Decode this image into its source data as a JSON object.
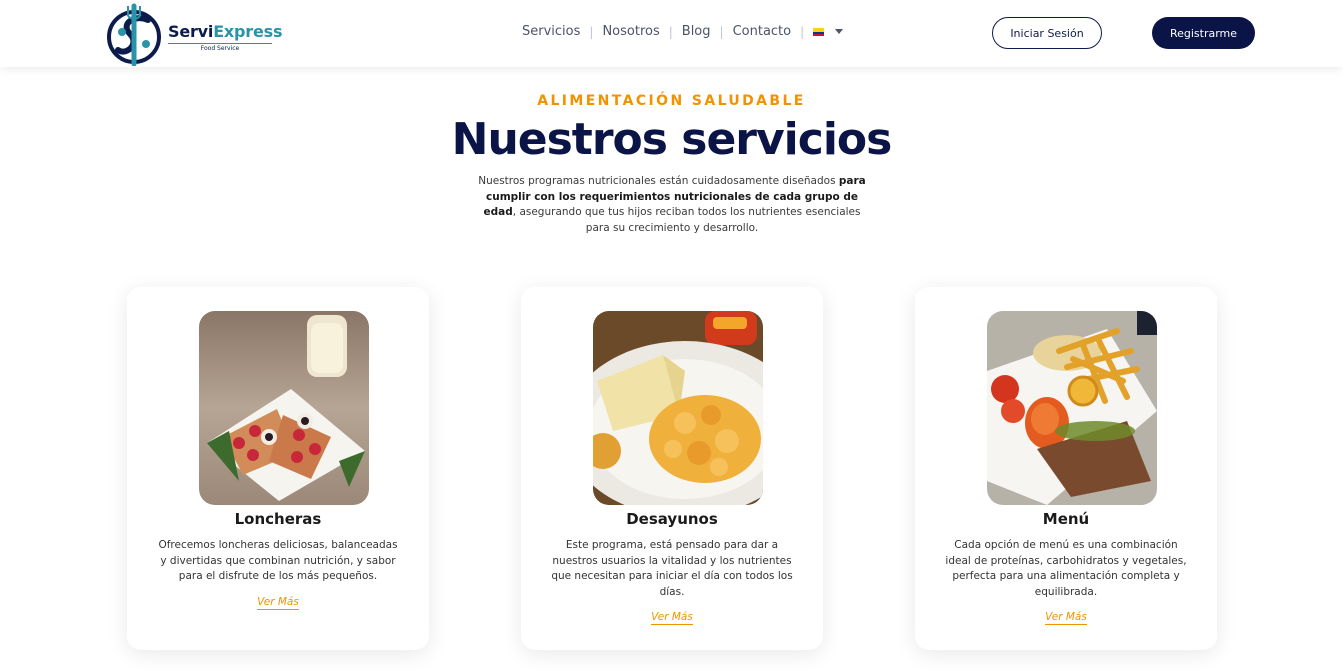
{
  "brand": {
    "name_part1": "Servi",
    "name_part2": "Express",
    "tagline": "Food Service"
  },
  "nav": {
    "items": [
      "Servicios",
      "Nosotros",
      "Blog",
      "Contacto"
    ],
    "language_flag": "colombia-flag-icon"
  },
  "auth": {
    "login_label": "Iniciar Sesión",
    "register_label": "Registrarme"
  },
  "hero": {
    "eyebrow": "ALIMENTACIÓN SALUDABLE",
    "title": "Nuestros servicios",
    "intro_part1": "Nuestros programas nutricionales están cuidadosamente diseñados ",
    "intro_bold": "para cumplir con los requerimientos nutricionales de cada grupo de edad",
    "intro_part2": ", asegurando que tus hijos reciban todos los nutrientes esenciales para su crecimiento y desarrollo."
  },
  "cards": [
    {
      "title": "Loncheras",
      "description": "Ofrecemos loncheras deliciosas, balanceadas y divertidas que combinan nutrición, y sabor para el disfrute de los más pequeños.",
      "link": "Ver Más"
    },
    {
      "title": "Desayunos",
      "description": "Este programa, está pensado para dar a nuestros usuarios la vitalidad y los nutrientes que necesitan para iniciar el día con todos los días.",
      "link": "Ver Más"
    },
    {
      "title": "Menú",
      "description": "Cada opción de menú es una combinación ideal de proteínas, carbohidratos y vegetales, perfecta para una alimentación completa y equilibrada.",
      "link": "Ver Más"
    }
  ],
  "colors": {
    "navy": "#0a1447",
    "orange": "#f39200",
    "teal": "#2a93a8"
  }
}
